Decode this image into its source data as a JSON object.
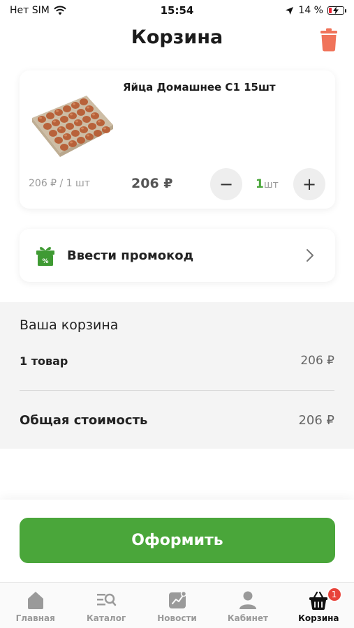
{
  "status_bar": {
    "carrier": "Нет SIM",
    "time": "15:54",
    "battery_percent": "14 %",
    "battery_level": 0.14,
    "icons": [
      "wifi-icon",
      "location-arrow-icon",
      "battery-charging-icon"
    ]
  },
  "header": {
    "title": "Корзина",
    "trash_icon": "trash-icon",
    "accent_color": "#f0735a"
  },
  "cart_item": {
    "name": "Яйца Домашнее С1 15шт",
    "image_icon": "eggs-tray-image",
    "unit_price": "206 ₽ / 1 шт",
    "line_price": "206 ₽",
    "minus_label": "−",
    "plus_label": "+",
    "quantity": "1",
    "quantity_unit": "шт"
  },
  "promo": {
    "label": "Ввести промокод",
    "icon": "gift-percent-icon",
    "chevron": "chevron-right-icon"
  },
  "summary": {
    "title": "Ваша корзина",
    "items_count": "1 товар",
    "items_price": "206 ₽",
    "total_label": "Общая стоимость",
    "total_price": "206 ₽"
  },
  "checkout": {
    "label": "Оформить",
    "color": "#4aa63a"
  },
  "tabbar": {
    "tabs": [
      {
        "label": "Главная",
        "icon": "home-icon"
      },
      {
        "label": "Каталог",
        "icon": "catalog-search-icon"
      },
      {
        "label": "Новости",
        "icon": "news-icon"
      },
      {
        "label": "Кабинет",
        "icon": "user-icon"
      },
      {
        "label": "Корзина",
        "icon": "basket-icon",
        "badge": "1",
        "active": true
      }
    ]
  }
}
